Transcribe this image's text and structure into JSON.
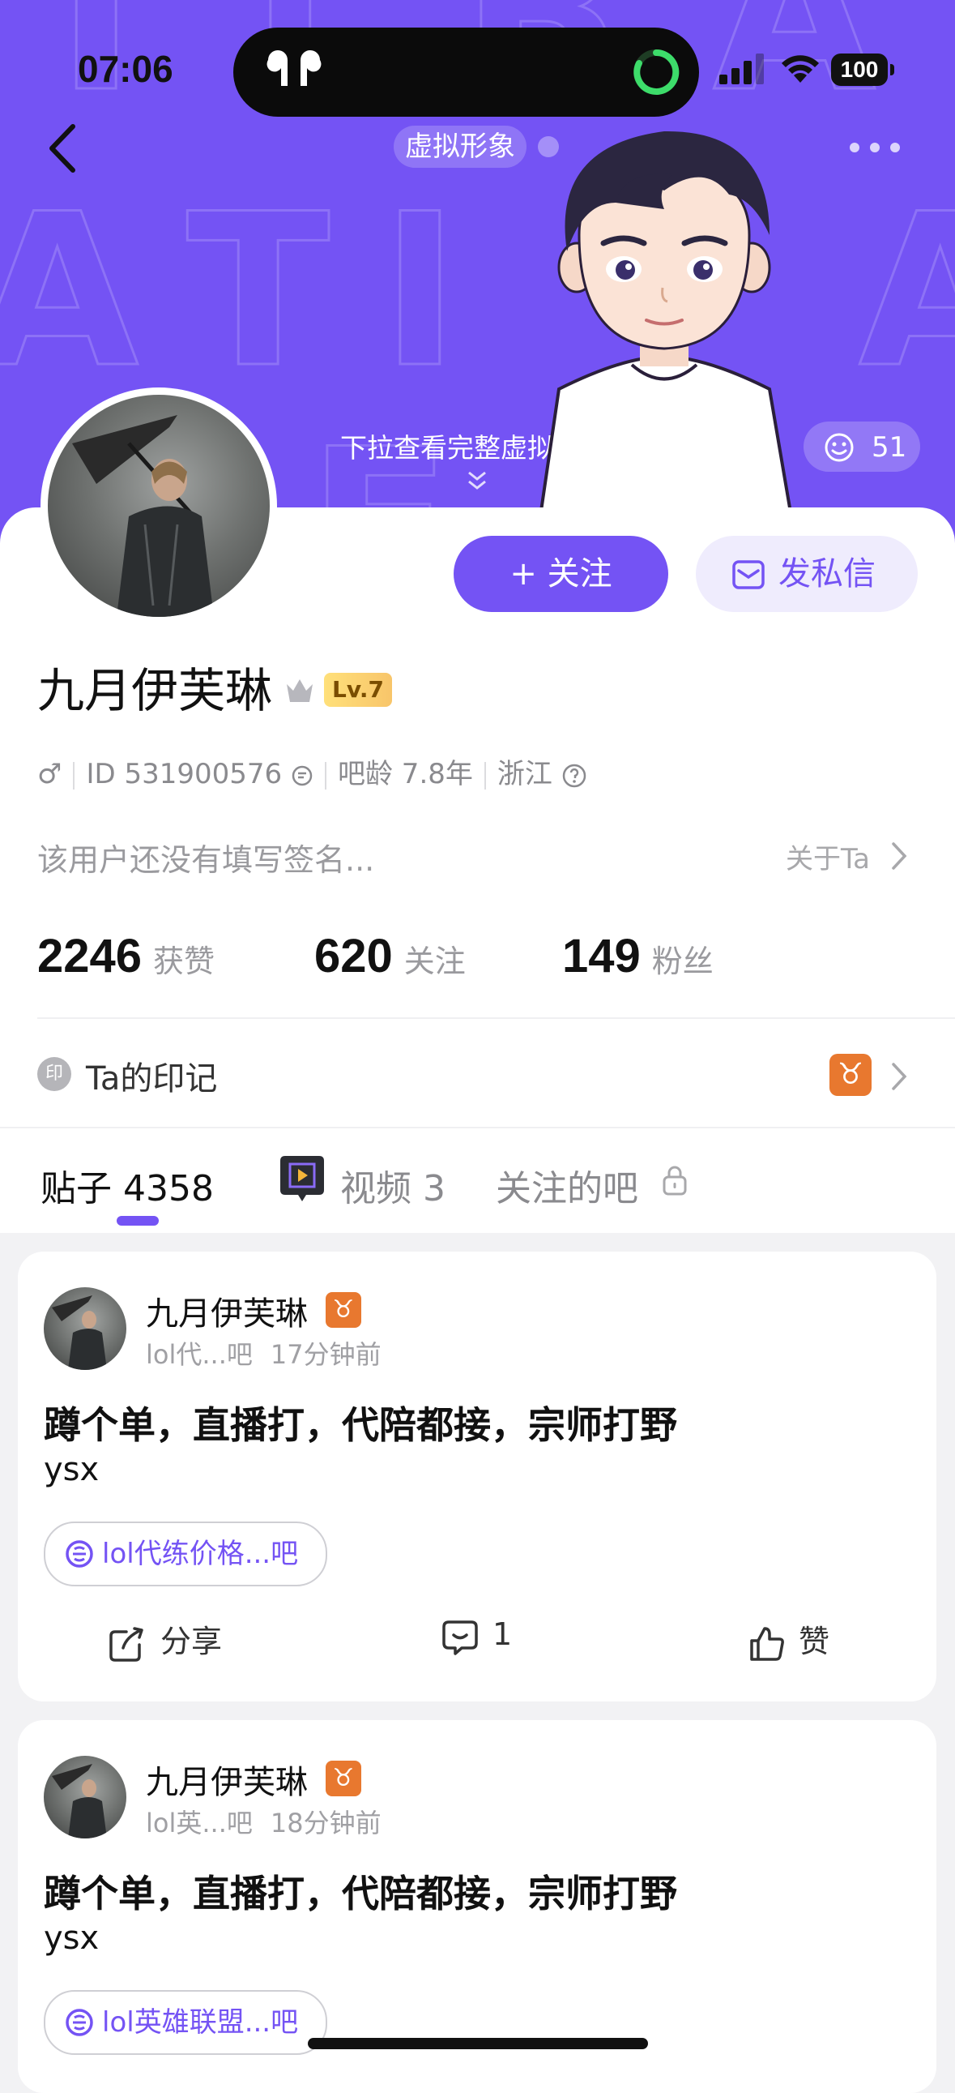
{
  "status_bar": {
    "time": "07:06",
    "battery": "100"
  },
  "header": {
    "avatar_chip": "虚拟形象",
    "pull_hint": "下拉查看完整虚拟形象",
    "like_count": "51"
  },
  "profile": {
    "follow_label": "+ 关注",
    "message_label": "发私信",
    "username": "九月伊芙琳",
    "level": "Lv.7",
    "gender": "♂",
    "id": "ID 531900576",
    "bar_age": "吧龄 7.8年",
    "location": "浙江",
    "signature": "该用户还没有填写签名...",
    "about_label": "关于Ta",
    "stats": [
      {
        "num": "2246",
        "label": "获赞"
      },
      {
        "num": "620",
        "label": "关注"
      },
      {
        "num": "149",
        "label": "粉丝"
      }
    ],
    "mark_icon": "印",
    "mark_label": "Ta的印记",
    "zodiac": "♉"
  },
  "tabs": {
    "posts": "贴子 4358",
    "videos": "视频 3",
    "followed_bars": "关注的吧"
  },
  "posts": [
    {
      "author": "九月伊芙琳",
      "bar": "lol代...吧",
      "time": "17分钟前",
      "title": "蹲个单，直播打，代陪都接，宗师打野",
      "body": "ysx",
      "tag": "lol代练价格...吧",
      "share": "分享",
      "comments": "1",
      "like": "赞"
    },
    {
      "author": "九月伊芙琳",
      "bar": "lol英...吧",
      "time": "18分钟前",
      "title": "蹲个单，直播打，代陪都接，宗师打野",
      "body": "ysx",
      "tag": "lol英雄联盟...吧"
    }
  ]
}
